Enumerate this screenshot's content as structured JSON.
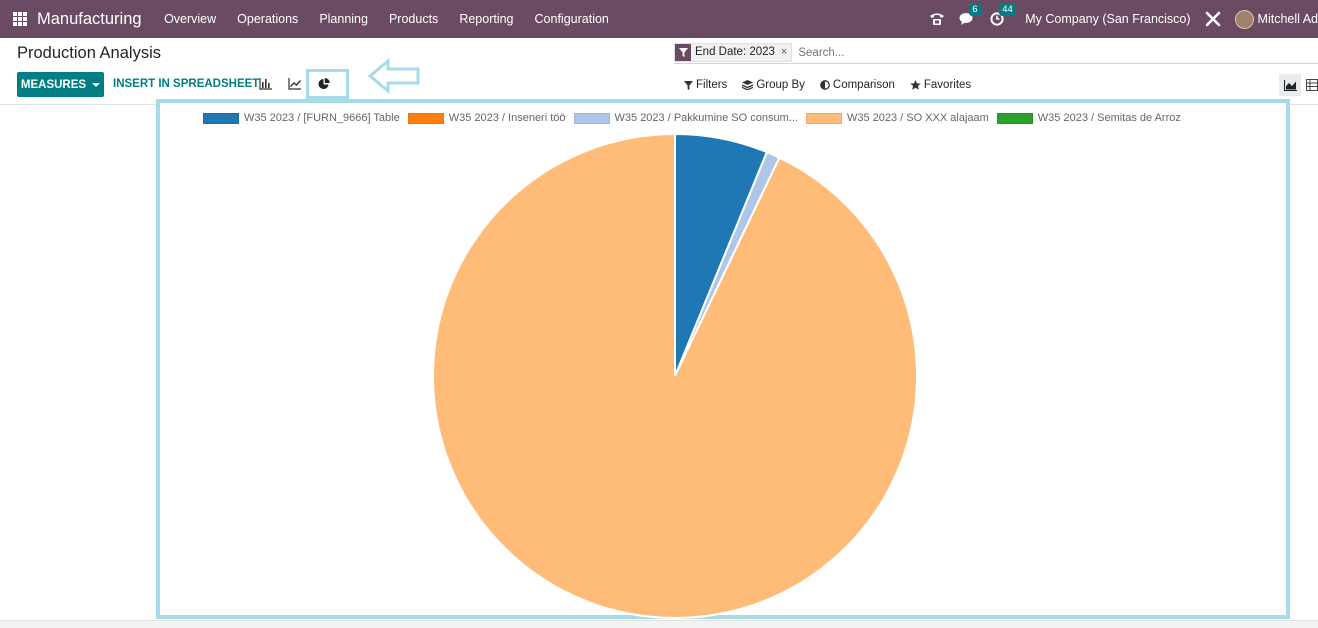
{
  "navbar": {
    "app_name": "Manufacturing",
    "menu": [
      "Overview",
      "Operations",
      "Planning",
      "Products",
      "Reporting",
      "Configuration"
    ],
    "messages_count": "6",
    "activities_count": "44",
    "company": "My Company (San Francisco)",
    "user": "Mitchell Ad"
  },
  "control_panel": {
    "title": "Production Analysis",
    "facet": "End Date: 2023",
    "facet_close": "×",
    "search_placeholder": "Search...",
    "measures_label": "MEASURES",
    "insert_label": "INSERT IN SPREADSHEET",
    "filters_label": "Filters",
    "groupby_label": "Group By",
    "comparison_label": "Comparison",
    "favorites_label": "Favorites"
  },
  "colors": {
    "navbar": "#6a4b63",
    "primary": "#017e84",
    "annotation": "#a7dbe8"
  },
  "chart_data": {
    "type": "pie",
    "legend_position": "top",
    "series": [
      {
        "name": "W35 2023 / [FURN_9666] Table",
        "value": 6.2,
        "color": "#1f77b4"
      },
      {
        "name": "W35 2023 / Inseneri töö",
        "value": 0.0,
        "color": "#ff7f0e"
      },
      {
        "name": "W35 2023 / Pakkumine SO consum...",
        "value": 0.9,
        "color": "#aec7e8"
      },
      {
        "name": "W35 2023 / SO XXX alajaam",
        "value": 92.9,
        "color": "#ffbb78"
      },
      {
        "name": "W35 2023 / Semitas de Arroz",
        "value": 0.0,
        "color": "#2ca02c"
      }
    ]
  }
}
